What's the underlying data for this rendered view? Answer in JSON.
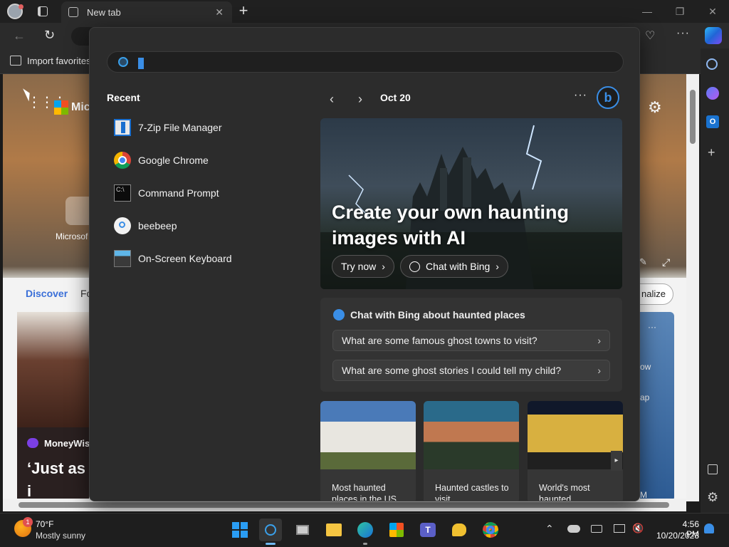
{
  "browser": {
    "tab_title": "New tab",
    "favorites_label": "Import favorites",
    "ntp_brand_partial": "Mic",
    "ntp_shortcut_partial": "Microsof",
    "feed_tabs": [
      "Discover",
      "Fo"
    ],
    "personalize_partial": "nalize",
    "story_source": "MoneyWise",
    "story_headline_partial": "‘Just as i country",
    "right_card_partials": [
      "ow",
      "ap",
      "M"
    ]
  },
  "search": {
    "recent_title": "Recent",
    "recent": [
      {
        "label": "7-Zip File Manager",
        "icon": "7zip-icon"
      },
      {
        "label": "Google Chrome",
        "icon": "chrome-icon"
      },
      {
        "label": "Command Prompt",
        "icon": "cmd-icon"
      },
      {
        "label": "beebeep",
        "icon": "search-result-icon"
      },
      {
        "label": "On-Screen Keyboard",
        "icon": "keyboard-icon"
      }
    ],
    "date": "Oct 20",
    "hero": {
      "title": "Create your own haunting images with AI",
      "try_now": "Try now",
      "chat_bing": "Chat with Bing"
    },
    "chat_card": {
      "title": "Chat with Bing about haunted places",
      "questions": [
        "What are some famous ghost towns to visit?",
        "What are some ghost stories I could tell my child?"
      ]
    },
    "cards": [
      "Most haunted places in the US",
      "Haunted castles to visit",
      "World's most haunted"
    ]
  },
  "taskbar": {
    "weather_temp": "70°F",
    "weather_desc": "Mostly sunny",
    "weather_badge": "1",
    "time": "4:56 PM",
    "date": "10/20/2023"
  },
  "colors": {
    "accent": "#3a8ee6",
    "panel_bg": "#2c2c2c"
  }
}
